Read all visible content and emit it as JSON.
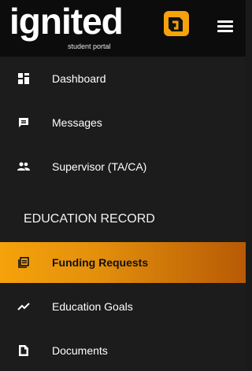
{
  "app": {
    "logo_text": "ignited",
    "logo_subtitle": "student portal",
    "accent": "#f5a20b"
  },
  "nav": {
    "items": [
      {
        "label": "Dashboard",
        "icon": "dashboard-icon"
      },
      {
        "label": "Messages",
        "icon": "message-icon"
      },
      {
        "label": "Supervisor (TA/CA)",
        "icon": "people-icon"
      }
    ],
    "section_title": "EDUCATION RECORD",
    "section_items": [
      {
        "label": "Funding Requests",
        "icon": "funding-icon",
        "active": true
      },
      {
        "label": "Education Goals",
        "icon": "trend-icon"
      },
      {
        "label": "Documents",
        "icon": "document-icon"
      }
    ]
  }
}
